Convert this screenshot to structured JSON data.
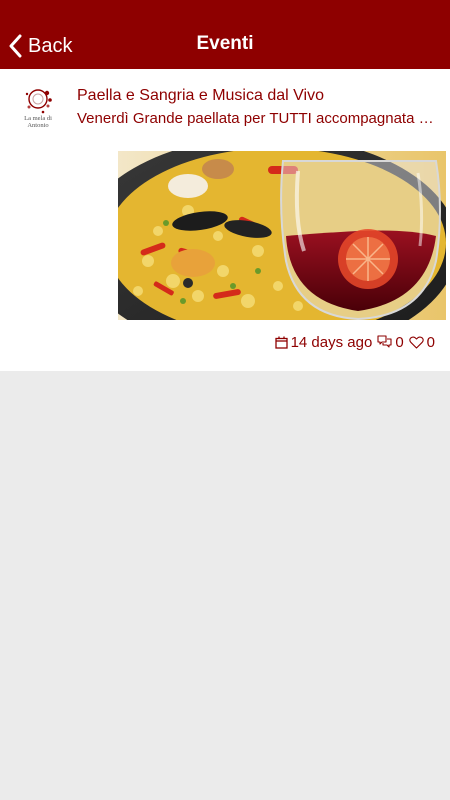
{
  "navbar": {
    "back_label": "Back",
    "title": "Eventi"
  },
  "event": {
    "title": "Paella e Sangria e Musica dal Vivo",
    "description": "Venerdì Grande paellata per TUTTI accompagnata da sangria e musica dal vivo",
    "logo_text_line1": "La mela di",
    "logo_text_line2": "Antonio",
    "time_ago": "14 days ago",
    "comments_count": "0",
    "likes_count": "0"
  },
  "colors": {
    "brand": "#8e0000",
    "background": "#ebebeb",
    "card": "#ffffff"
  },
  "icons": {
    "back": "chevron-left-icon",
    "date": "calendar-icon",
    "comments": "comments-icon",
    "likes": "heart-icon"
  }
}
